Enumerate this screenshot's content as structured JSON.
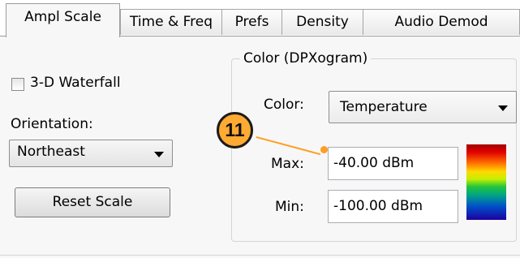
{
  "tabs": [
    {
      "label": "Ampl Scale",
      "active": true
    },
    {
      "label": "Time & Freq",
      "active": false
    },
    {
      "label": "Prefs",
      "active": false
    },
    {
      "label": "Density",
      "active": false
    },
    {
      "label": "Audio Demod",
      "active": false
    }
  ],
  "waterfall_checkbox": {
    "label": "3-D Waterfall",
    "checked": false
  },
  "orientation": {
    "label": "Orientation:",
    "selected": "Northeast"
  },
  "reset_button": {
    "label": "Reset Scale"
  },
  "dpx_group": {
    "title": "Color (DPXogram)",
    "color_label": "Color:",
    "color_selected": "Temperature",
    "max_label": "Max:",
    "max_value": "-40.00 dBm",
    "min_label": "Min:",
    "min_value": "-100.00 dBm"
  },
  "callout": {
    "number": "11",
    "color": "#ffaa33"
  },
  "colors": {
    "panel": "#f7f7f7",
    "accent": "#ff9e22",
    "border": "#9c9c9c"
  },
  "icons": {
    "dropdown": "chevron-down-icon",
    "colormap": "colormap-gradient"
  }
}
